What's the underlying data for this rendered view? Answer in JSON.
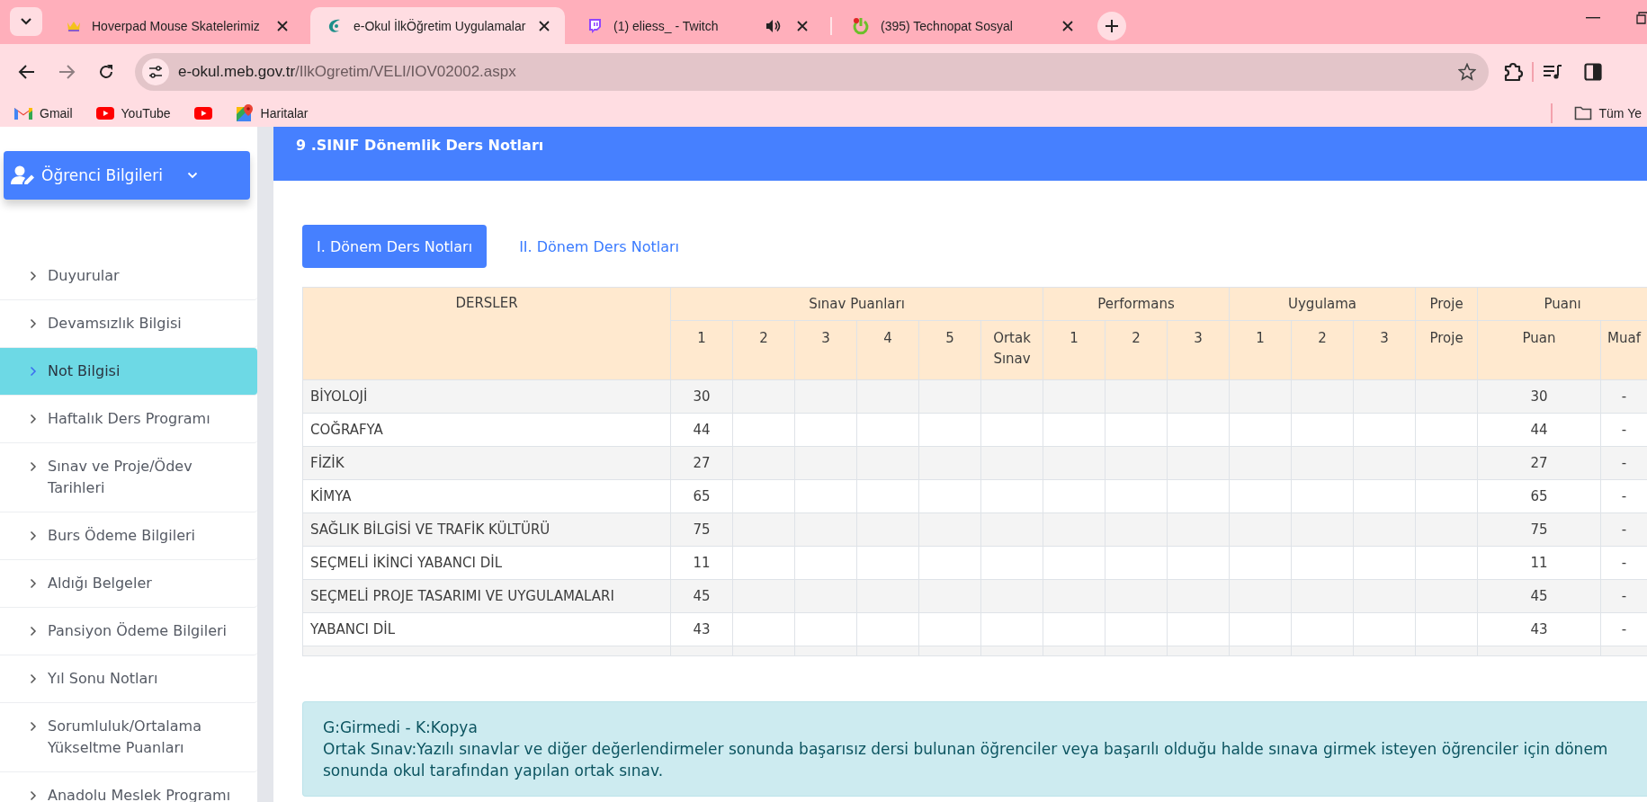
{
  "browser": {
    "tabs": [
      {
        "title": "Hoverpad Mouse Skatelerimiz",
        "kind": "crown",
        "selected": false,
        "audio": false
      },
      {
        "title": "e-Okul İlkÖğretim Uygulamalar",
        "kind": "eokul",
        "selected": true,
        "audio": false
      },
      {
        "title": "(1) eliess_ - Twitch",
        "kind": "twitch",
        "selected": false,
        "audio": true
      },
      {
        "title": "(395) Technopat Sosyal",
        "kind": "power",
        "selected": false,
        "audio": false
      }
    ],
    "forward": {
      "disabled": true
    },
    "address": {
      "host": "e-okul.meb.gov.tr",
      "path": "/IlkOgretim/VELI/IOV02002.aspx"
    },
    "bookmarks": [
      {
        "kind": "gmail",
        "label": "Gmail"
      },
      {
        "kind": "youtube",
        "label": "YouTube"
      },
      {
        "kind": "youtube"
      },
      {
        "kind": "maps",
        "label": "Haritalar"
      }
    ],
    "all_bookmarks": "Tüm Ye"
  },
  "sidebar": {
    "menu": {
      "title": "Öğrenci Bilgileri"
    },
    "items": [
      {
        "label": "Duyurular",
        "selected": false
      },
      {
        "label": "Devamsızlık Bilgisi",
        "selected": false
      },
      {
        "label": "Not Bilgisi",
        "selected": true
      },
      {
        "label": "Haftalık Ders Programı",
        "selected": false
      },
      {
        "label": "Sınav ve Proje/Ödev Tarihleri",
        "selected": false
      },
      {
        "label": "Burs Ödeme Bilgileri",
        "selected": false
      },
      {
        "label": "Aldığı Belgeler",
        "selected": false
      },
      {
        "label": "Pansiyon Ödeme Bilgileri",
        "selected": false
      },
      {
        "label": "Yıl Sonu Notları",
        "selected": false
      },
      {
        "label": "Sorumluluk/Ortalama Yükseltme Puanları",
        "selected": false
      },
      {
        "label": "Anadolu Meslek Programı",
        "selected": false
      }
    ]
  },
  "content": {
    "heading": "9 .SINIF Dönemlik Ders Notları",
    "period_tabs": [
      {
        "label": "I. Dönem Ders Notları",
        "selected": true
      },
      {
        "label": "II. Dönem Ders Notları",
        "selected": false
      }
    ],
    "table": {
      "groups": [
        {
          "label": "DERSLER"
        },
        {
          "label": "Sınav Puanları",
          "columns": [
            "1",
            "2",
            "3",
            "4",
            "5",
            "Ortak Sınav"
          ]
        },
        {
          "label": "Performans",
          "columns": [
            "1",
            "2",
            "3"
          ]
        },
        {
          "label": "Uygulama",
          "columns": [
            "1",
            "2",
            "3"
          ]
        },
        {
          "label": "Proje",
          "columns": [
            "Proje"
          ]
        },
        {
          "label": "Puanı",
          "columns": [
            "Puan",
            "Muaf"
          ]
        }
      ],
      "rows": [
        {
          "subject": "BİYOLOJİ",
          "exam_1": "30",
          "score": "30",
          "exempt": "-"
        },
        {
          "subject": "COĞRAFYA",
          "exam_1": "44",
          "score": "44",
          "exempt": "-"
        },
        {
          "subject": "FİZİK",
          "exam_1": "27",
          "score": "27",
          "exempt": "-"
        },
        {
          "subject": "KİMYA",
          "exam_1": "65",
          "score": "65",
          "exempt": "-"
        },
        {
          "subject": "SAĞLIK BİLGİSİ VE TRAFİK KÜLTÜRÜ",
          "exam_1": "75",
          "score": "75",
          "exempt": "-"
        },
        {
          "subject": "SEÇMELİ İKİNCİ YABANCI DİL",
          "exam_1": "11",
          "score": "11",
          "exempt": "-"
        },
        {
          "subject": "SEÇMELİ PROJE TASARIMI VE UYGULAMALARI",
          "exam_1": "45",
          "score": "45",
          "exempt": "-"
        },
        {
          "subject": "YABANCI DİL",
          "exam_1": "43",
          "score": "43",
          "exempt": "-"
        }
      ]
    },
    "notes": [
      "G:Girmedi - K:Kopya",
      "Ortak Sınav:Yazılı sınavlar ve diğer değerlendirmeler sonunda başarısız dersi bulunan öğrenciler veya başarılı olduğu halde sınava girmek isteyen öğrenciler için dönem sonunda okul tarafından yapılan ortak sınav."
    ]
  }
}
